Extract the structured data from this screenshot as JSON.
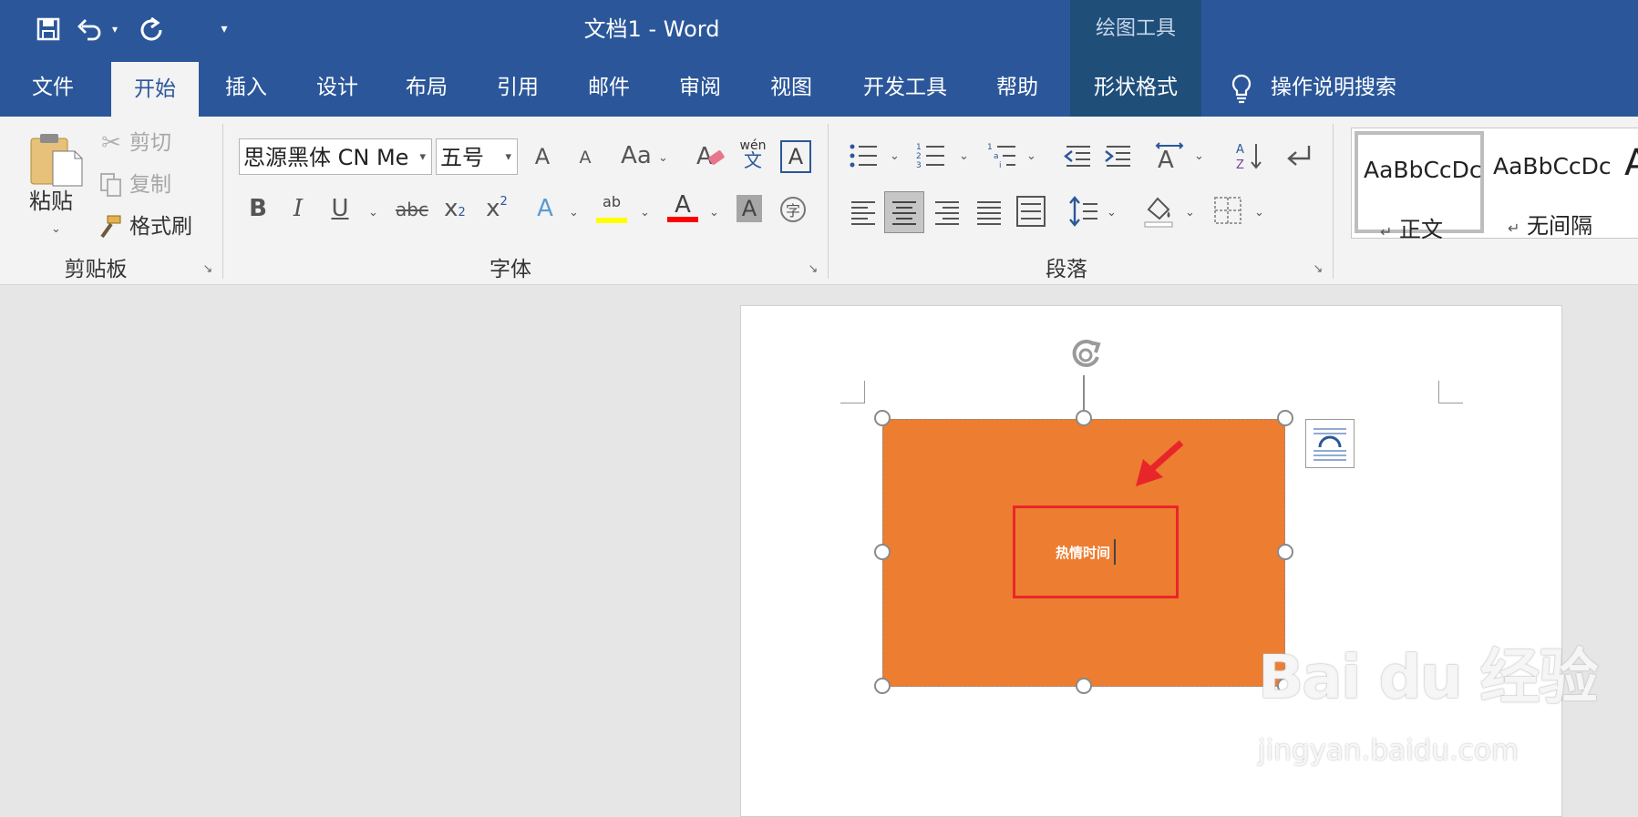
{
  "titlebar": {
    "doc_title": "文档1  -  Word",
    "context_tool": "绘图工具",
    "qat_icons": [
      "save-icon",
      "undo-icon",
      "redo-icon",
      "customize-qat-icon"
    ]
  },
  "tabs": [
    {
      "label": "文件"
    },
    {
      "label": "开始"
    },
    {
      "label": "插入"
    },
    {
      "label": "设计"
    },
    {
      "label": "布局"
    },
    {
      "label": "引用"
    },
    {
      "label": "邮件"
    },
    {
      "label": "审阅"
    },
    {
      "label": "视图"
    },
    {
      "label": "开发工具"
    },
    {
      "label": "帮助"
    },
    {
      "label": "形状格式"
    }
  ],
  "tell_me": "操作说明搜索",
  "clipboard": {
    "paste": "粘贴",
    "cut": "剪切",
    "copy": "复制",
    "format_painter": "格式刷",
    "group": "剪贴板"
  },
  "font": {
    "font_name": "思源黑体 CN Me",
    "font_size": "五号",
    "grow": "A",
    "shrink": "A",
    "change_case": "Aa",
    "phonetic_top": "wén",
    "phonetic_bottom": "文",
    "border_char": "A",
    "bold": "B",
    "italic": "I",
    "underline": "U",
    "strike": "abc",
    "subscript": "x",
    "subscript_small": "2",
    "superscript": "x",
    "superscript_small": "2",
    "text_effects": "A",
    "highlight": "ab",
    "font_color": "A",
    "char_shading": "A",
    "enclose_char": "字",
    "group": "字体"
  },
  "paragraph": {
    "group": "段落"
  },
  "styles": [
    {
      "sample": "AaBbCcDc",
      "name": "正文"
    },
    {
      "sample": "AaBbCcDc",
      "name": "无间隔"
    },
    {
      "sample": "A"
    }
  ],
  "styles_para_mark": "↵",
  "document": {
    "shape_text": "热情时间"
  },
  "watermark": {
    "logo": "Bai du 经验",
    "url": "jingyan.baidu.com"
  },
  "colors": {
    "word_blue": "#2b579a",
    "shape_orange": "#ed7d31",
    "annotation_red": "#e8262a"
  }
}
